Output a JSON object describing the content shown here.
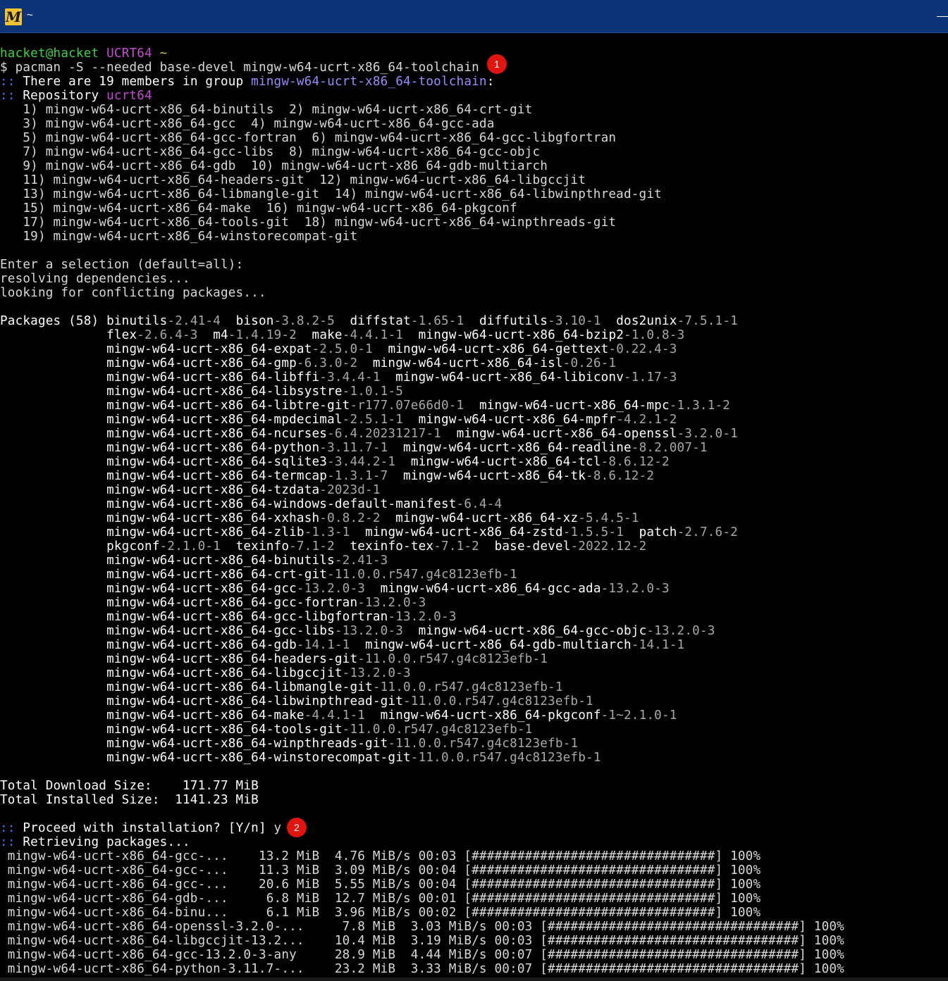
{
  "window": {
    "title": "~",
    "icon": "msys2-m-icon"
  },
  "prompt": {
    "user": "hacket@hacket",
    "env": "UCRT64",
    "dir": "~"
  },
  "command": "$ pacman -S --needed base-devel mingw-w64-ucrt-x86_64-toolchain",
  "group_line": {
    "prefix": "::",
    "text": " There are 19 members in group ",
    "group": "mingw-w64-ucrt-x86_64-toolchain",
    "suffix": ":"
  },
  "repo_line": {
    "prefix": "::",
    "text": " Repository ",
    "repo": "ucrt64"
  },
  "members": [
    "   1) mingw-w64-ucrt-x86_64-binutils  2) mingw-w64-ucrt-x86_64-crt-git",
    "   3) mingw-w64-ucrt-x86_64-gcc  4) mingw-w64-ucrt-x86_64-gcc-ada",
    "   5) mingw-w64-ucrt-x86_64-gcc-fortran  6) mingw-w64-ucrt-x86_64-gcc-libgfortran",
    "   7) mingw-w64-ucrt-x86_64-gcc-libs  8) mingw-w64-ucrt-x86_64-gcc-objc",
    "   9) mingw-w64-ucrt-x86_64-gdb  10) mingw-w64-ucrt-x86_64-gdb-multiarch",
    "   11) mingw-w64-ucrt-x86_64-headers-git  12) mingw-w64-ucrt-x86_64-libgccjit",
    "   13) mingw-w64-ucrt-x86_64-libmangle-git  14) mingw-w64-ucrt-x86_64-libwinpthread-git",
    "   15) mingw-w64-ucrt-x86_64-make  16) mingw-w64-ucrt-x86_64-pkgconf",
    "   17) mingw-w64-ucrt-x86_64-tools-git  18) mingw-w64-ucrt-x86_64-winpthreads-git",
    "   19) mingw-w64-ucrt-x86_64-winstorecompat-git"
  ],
  "selection_prompt": "Enter a selection (default=all):",
  "resolving": "resolving dependencies...",
  "conflicts": "looking for conflicting packages...",
  "packages_label": "Packages (58) ",
  "package_lines": [
    [
      [
        "binutils",
        "-2.41-4"
      ],
      [
        "bison",
        "-3.8.2-5"
      ],
      [
        "diffstat",
        "-1.65-1"
      ],
      [
        "diffutils",
        "-3.10-1"
      ],
      [
        "dos2unix",
        "-7.5.1-1"
      ]
    ],
    [
      [
        "flex",
        "-2.6.4-3"
      ],
      [
        "m4",
        "-1.4.19-2"
      ],
      [
        "make",
        "-4.4.1-1"
      ],
      [
        "mingw-w64-ucrt-x86_64-bzip2",
        "-1.0.8-3"
      ]
    ],
    [
      [
        "mingw-w64-ucrt-x86_64-expat",
        "-2.5.0-1"
      ],
      [
        "mingw-w64-ucrt-x86_64-gettext",
        "-0.22.4-3"
      ]
    ],
    [
      [
        "mingw-w64-ucrt-x86_64-gmp",
        "-6.3.0-2"
      ],
      [
        "mingw-w64-ucrt-x86_64-isl",
        "-0.26-1"
      ]
    ],
    [
      [
        "mingw-w64-ucrt-x86_64-libffi",
        "-3.4.4-1"
      ],
      [
        "mingw-w64-ucrt-x86_64-libiconv",
        "-1.17-3"
      ]
    ],
    [
      [
        "mingw-w64-ucrt-x86_64-libsystre",
        "-1.0.1-5"
      ]
    ],
    [
      [
        "mingw-w64-ucrt-x86_64-libtre-git",
        "-r177.07e66d0-1"
      ],
      [
        "mingw-w64-ucrt-x86_64-mpc",
        "-1.3.1-2"
      ]
    ],
    [
      [
        "mingw-w64-ucrt-x86_64-mpdecimal",
        "-2.5.1-1"
      ],
      [
        "mingw-w64-ucrt-x86_64-mpfr",
        "-4.2.1-2"
      ]
    ],
    [
      [
        "mingw-w64-ucrt-x86_64-ncurses",
        "-6.4.20231217-1"
      ],
      [
        "mingw-w64-ucrt-x86_64-openssl",
        "-3.2.0-1"
      ]
    ],
    [
      [
        "mingw-w64-ucrt-x86_64-python",
        "-3.11.7-1"
      ],
      [
        "mingw-w64-ucrt-x86_64-readline",
        "-8.2.007-1"
      ]
    ],
    [
      [
        "mingw-w64-ucrt-x86_64-sqlite3",
        "-3.44.2-1"
      ],
      [
        "mingw-w64-ucrt-x86_64-tcl",
        "-8.6.12-2"
      ]
    ],
    [
      [
        "mingw-w64-ucrt-x86_64-termcap",
        "-1.3.1-7"
      ],
      [
        "mingw-w64-ucrt-x86_64-tk",
        "-8.6.12-2"
      ]
    ],
    [
      [
        "mingw-w64-ucrt-x86_64-tzdata",
        "-2023d-1"
      ]
    ],
    [
      [
        "mingw-w64-ucrt-x86_64-windows-default-manifest",
        "-6.4-4"
      ]
    ],
    [
      [
        "mingw-w64-ucrt-x86_64-xxhash",
        "-0.8.2-2"
      ],
      [
        "mingw-w64-ucrt-x86_64-xz",
        "-5.4.5-1"
      ]
    ],
    [
      [
        "mingw-w64-ucrt-x86_64-zlib",
        "-1.3-1"
      ],
      [
        "mingw-w64-ucrt-x86_64-zstd",
        "-1.5.5-1"
      ],
      [
        "patch",
        "-2.7.6-2"
      ]
    ],
    [
      [
        "pkgconf",
        "-2.1.0-1"
      ],
      [
        "texinfo",
        "-7.1-2"
      ],
      [
        "texinfo-tex",
        "-7.1-2"
      ],
      [
        "base-devel",
        "-2022.12-2"
      ]
    ],
    [
      [
        "mingw-w64-ucrt-x86_64-binutils",
        "-2.41-3"
      ]
    ],
    [
      [
        "mingw-w64-ucrt-x86_64-crt-git",
        "-11.0.0.r547.g4c8123efb-1"
      ]
    ],
    [
      [
        "mingw-w64-ucrt-x86_64-gcc",
        "-13.2.0-3"
      ],
      [
        "mingw-w64-ucrt-x86_64-gcc-ada",
        "-13.2.0-3"
      ]
    ],
    [
      [
        "mingw-w64-ucrt-x86_64-gcc-fortran",
        "-13.2.0-3"
      ]
    ],
    [
      [
        "mingw-w64-ucrt-x86_64-gcc-libgfortran",
        "-13.2.0-3"
      ]
    ],
    [
      [
        "mingw-w64-ucrt-x86_64-gcc-libs",
        "-13.2.0-3"
      ],
      [
        "mingw-w64-ucrt-x86_64-gcc-objc",
        "-13.2.0-3"
      ]
    ],
    [
      [
        "mingw-w64-ucrt-x86_64-gdb",
        "-14.1-1"
      ],
      [
        "mingw-w64-ucrt-x86_64-gdb-multiarch",
        "-14.1-1"
      ]
    ],
    [
      [
        "mingw-w64-ucrt-x86_64-headers-git",
        "-11.0.0.r547.g4c8123efb-1"
      ]
    ],
    [
      [
        "mingw-w64-ucrt-x86_64-libgccjit",
        "-13.2.0-3"
      ]
    ],
    [
      [
        "mingw-w64-ucrt-x86_64-libmangle-git",
        "-11.0.0.r547.g4c8123efb-1"
      ]
    ],
    [
      [
        "mingw-w64-ucrt-x86_64-libwinpthread-git",
        "-11.0.0.r547.g4c8123efb-1"
      ]
    ],
    [
      [
        "mingw-w64-ucrt-x86_64-make",
        "-4.4.1-1"
      ],
      [
        "mingw-w64-ucrt-x86_64-pkgconf",
        "-1~2.1.0-1"
      ]
    ],
    [
      [
        "mingw-w64-ucrt-x86_64-tools-git",
        "-11.0.0.r547.g4c8123efb-1"
      ]
    ],
    [
      [
        "mingw-w64-ucrt-x86_64-winpthreads-git",
        "-11.0.0.r547.g4c8123efb-1"
      ]
    ],
    [
      [
        "mingw-w64-ucrt-x86_64-winstorecompat-git",
        "-11.0.0.r547.g4c8123efb-1"
      ]
    ]
  ],
  "total_download": "Total Download Size:    171.77 MiB",
  "total_installed": "Total Installed Size:  1141.23 MiB",
  "proceed": {
    "prefix": "::",
    "text": " Proceed with installation? [Y/n] ",
    "answer": "y"
  },
  "retrieving": {
    "prefix": "::",
    "text": " Retrieving packages..."
  },
  "downloads": [
    " mingw-w64-ucrt-x86_64-gcc-...    13.2 MiB  4.76 MiB/s 00:03 [################################] 100%",
    " mingw-w64-ucrt-x86_64-gcc-...    11.3 MiB  3.09 MiB/s 00:04 [################################] 100%",
    " mingw-w64-ucrt-x86_64-gcc-...    20.6 MiB  5.55 MiB/s 00:04 [################################] 100%",
    " mingw-w64-ucrt-x86_64-gdb-...     6.8 MiB  12.7 MiB/s 00:01 [################################] 100%",
    " mingw-w64-ucrt-x86_64-binu...     6.1 MiB  3.96 MiB/s 00:02 [################################] 100%",
    " mingw-w64-ucrt-x86_64-openssl-3.2.0-...     7.8 MiB  3.03 MiB/s 00:03 [#################################] 100%",
    " mingw-w64-ucrt-x86_64-libgccjit-13.2...    10.4 MiB  3.19 MiB/s 00:03 [#################################] 100%",
    " mingw-w64-ucrt-x86_64-gcc-13.2.0-3-any     28.9 MiB  4.44 MiB/s 00:07 [#################################] 100%",
    " mingw-w64-ucrt-x86_64-python-3.11.7-...    23.2 MiB  3.33 MiB/s 00:07 [#################################] 100%"
  ],
  "annotations": [
    "1",
    "2"
  ]
}
